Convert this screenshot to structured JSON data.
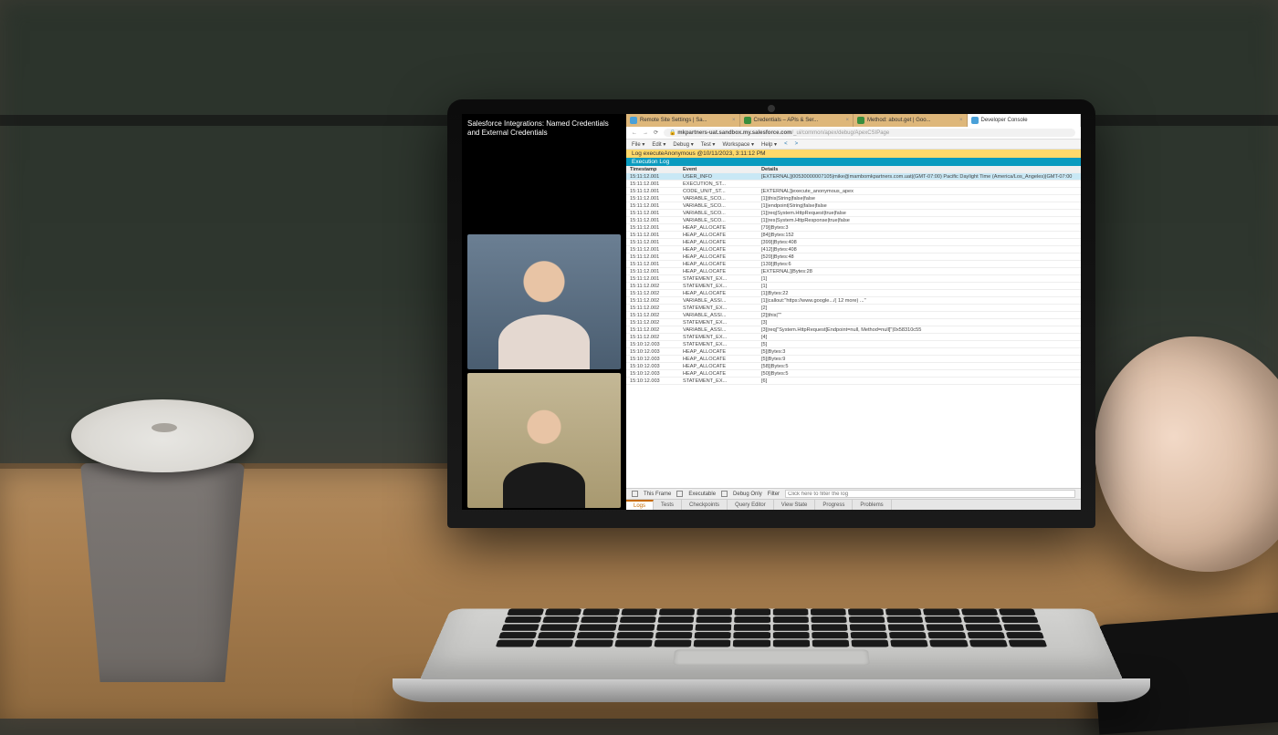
{
  "call": {
    "title": "Salesforce Integrations: Named Credentials and External Credentials"
  },
  "browser": {
    "tabs": [
      {
        "label": "Remote Site Settings | Sa..."
      },
      {
        "label": "Credentials – APIs & Ser..."
      },
      {
        "label": "Method: about.get | Goo..."
      },
      {
        "label": "Developer Console"
      }
    ],
    "url_host": "mkpartners-uat.sandbox.my.salesforce.com",
    "url_path": "/_ui/common/apex/debug/ApexCSIPage"
  },
  "menubar": [
    "File ▾",
    "Edit ▾",
    "Debug ▾",
    "Test ▾",
    "Workspace ▾",
    "Help ▾",
    "<",
    ">"
  ],
  "log_banner": "Log executeAnonymous @10/11/2023, 3:11:12 PM",
  "execution_log_label": "Execution Log",
  "columns": {
    "ts": "Timestamp",
    "ev": "Event",
    "dt": "Details"
  },
  "rows": [
    {
      "ts": "15:11:12.001",
      "ev": "USER_INFO",
      "dt": "[EXTERNAL]|00530000007105|mike@mambomkpartners.com.uat|(GMT-07:00) Pacific Daylight Time (America/Los_Angeles)|GMT-07:00",
      "sel": true
    },
    {
      "ts": "15:11:12.001",
      "ev": "EXECUTION_ST...",
      "dt": ""
    },
    {
      "ts": "15:11:12.001",
      "ev": "CODE_UNIT_ST...",
      "dt": "[EXTERNAL]|execute_anonymous_apex"
    },
    {
      "ts": "15:11:12.001",
      "ev": "VARIABLE_SCO...",
      "dt": "[1]|this|String|false|false"
    },
    {
      "ts": "15:11:12.001",
      "ev": "VARIABLE_SCO...",
      "dt": "[1]|endpoint|String|false|false"
    },
    {
      "ts": "15:11:12.001",
      "ev": "VARIABLE_SCO...",
      "dt": "[1]|req|System.HttpRequest|true|false"
    },
    {
      "ts": "15:11:12.001",
      "ev": "VARIABLE_SCO...",
      "dt": "[1]|res|System.HttpResponse|true|false"
    },
    {
      "ts": "15:11:12.001",
      "ev": "HEAP_ALLOCATE",
      "dt": "[79]|Bytes:3"
    },
    {
      "ts": "15:11:12.001",
      "ev": "HEAP_ALLOCATE",
      "dt": "[84]|Bytes:152"
    },
    {
      "ts": "15:11:12.001",
      "ev": "HEAP_ALLOCATE",
      "dt": "[399]|Bytes:408"
    },
    {
      "ts": "15:11:12.001",
      "ev": "HEAP_ALLOCATE",
      "dt": "[412]|Bytes:408"
    },
    {
      "ts": "15:11:12.001",
      "ev": "HEAP_ALLOCATE",
      "dt": "[520]|Bytes:48"
    },
    {
      "ts": "15:11:12.001",
      "ev": "HEAP_ALLOCATE",
      "dt": "[139]|Bytes:6"
    },
    {
      "ts": "15:11:12.001",
      "ev": "HEAP_ALLOCATE",
      "dt": "[EXTERNAL]|Bytes:28"
    },
    {
      "ts": "15:11:12.001",
      "ev": "STATEMENT_EX...",
      "dt": "[1]"
    },
    {
      "ts": "15:11:12.002",
      "ev": "STATEMENT_EX...",
      "dt": "[1]"
    },
    {
      "ts": "15:11:12.002",
      "ev": "HEAP_ALLOCATE",
      "dt": "[1]|Bytes:22"
    },
    {
      "ts": "15:11:12.002",
      "ev": "VARIABLE_ASSI...",
      "dt": "[1]|callout:\"https://www.google.../( 12 more) ...\""
    },
    {
      "ts": "15:11:12.002",
      "ev": "STATEMENT_EX...",
      "dt": "[2]"
    },
    {
      "ts": "15:11:12.002",
      "ev": "VARIABLE_ASSI...",
      "dt": "[2]|this|\"\""
    },
    {
      "ts": "15:11:12.002",
      "ev": "STATEMENT_EX...",
      "dt": "[3]"
    },
    {
      "ts": "15:11:12.002",
      "ev": "VARIABLE_ASSI...",
      "dt": "[3]|req|\"System.HttpRequest[Endpoint=null, Method=null]\"|0x58310c55"
    },
    {
      "ts": "15:11:12.002",
      "ev": "STATEMENT_EX...",
      "dt": "[4]"
    },
    {
      "ts": "15:10:12.003",
      "ev": "STATEMENT_EX...",
      "dt": "[5]"
    },
    {
      "ts": "15:10:12.003",
      "ev": "HEAP_ALLOCATE",
      "dt": "[5]|Bytes:3"
    },
    {
      "ts": "15:10:12.003",
      "ev": "HEAP_ALLOCATE",
      "dt": "[5]|Bytes:9"
    },
    {
      "ts": "15:10:12.003",
      "ev": "HEAP_ALLOCATE",
      "dt": "[58]|Bytes:5"
    },
    {
      "ts": "15:10:12.003",
      "ev": "HEAP_ALLOCATE",
      "dt": "[50]|Bytes:5"
    },
    {
      "ts": "15:10:12.003",
      "ev": "STATEMENT_EX...",
      "dt": "[6]"
    }
  ],
  "filter": {
    "this_frame": "This Frame",
    "executable": "Executable",
    "debug_only": "Debug Only",
    "filter_label": "Filter",
    "placeholder": "Click here to filter the log"
  },
  "bottom_tabs": [
    "Logs",
    "Tests",
    "Checkpoints",
    "Query Editor",
    "View State",
    "Progress",
    "Problems"
  ]
}
